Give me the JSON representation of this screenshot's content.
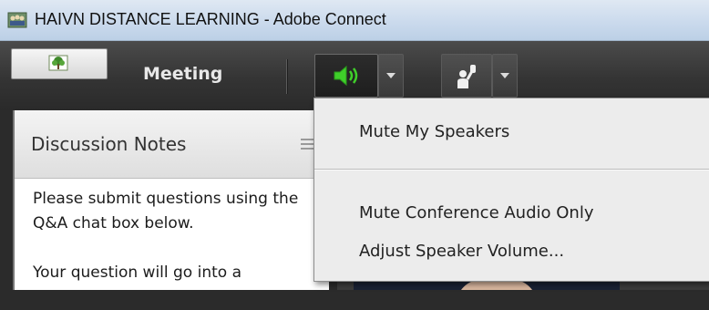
{
  "window": {
    "title": "HAIVN DISTANCE LEARNING - Adobe Connect",
    "icon": "adobe-connect-app-icon"
  },
  "toolbar": {
    "logo_icon": "tree-logo-icon",
    "meeting_menu": "Meeting",
    "speaker_icon": "speaker-volume-icon",
    "raise_hand_icon": "raise-hand-icon",
    "speaker_icon_color": "#3fcf2a"
  },
  "pod": {
    "title": "Discussion Notes",
    "paragraphs": [
      "Please submit questions using the Q&A chat box below.",
      "Your question will go into a"
    ]
  },
  "speaker_menu": {
    "items": [
      "Mute My Speakers",
      "Mute Conference Audio Only",
      "Adjust Speaker Volume..."
    ]
  }
}
